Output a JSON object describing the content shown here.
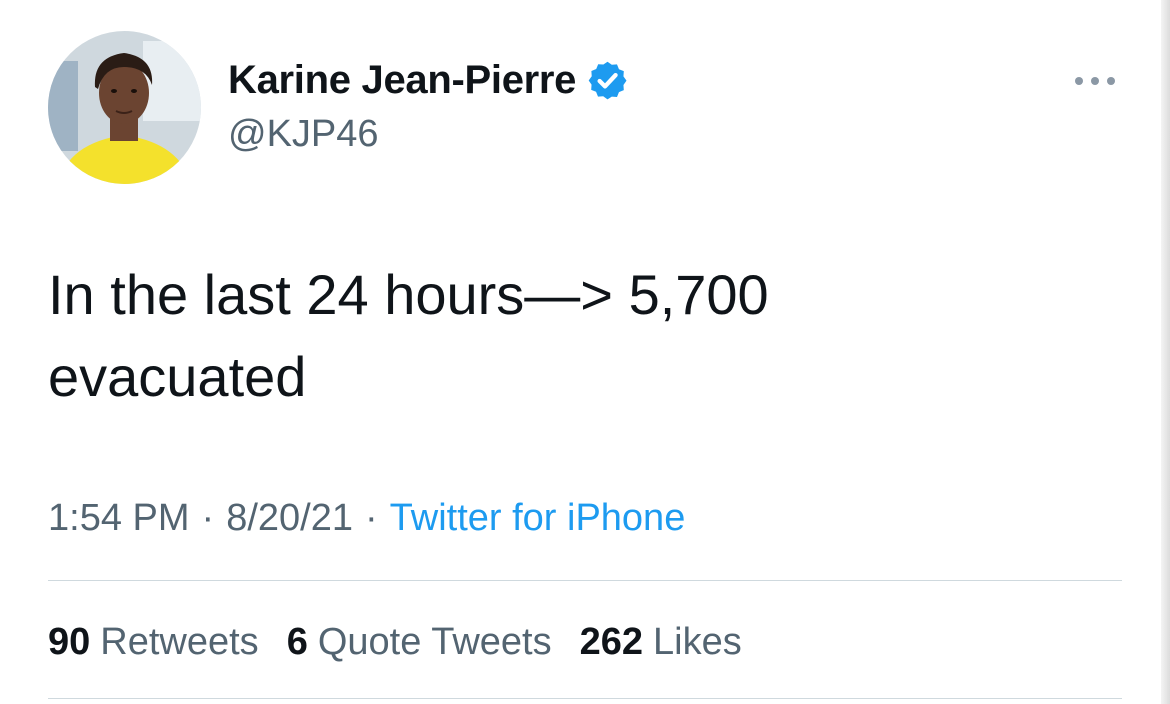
{
  "author": {
    "display_name": "Karine Jean-Pierre",
    "handle": "@KJP46",
    "verified": true,
    "avatar_colors": {
      "background": "#cfd8de",
      "skin": "#6b4431",
      "hair": "#2a1c15",
      "shirt": "#f4e12c"
    }
  },
  "tweet": {
    "text": "In the last 24 hours—> 5,700\nevacuated"
  },
  "meta": {
    "time": "1:54 PM",
    "separator": "·",
    "date": "8/20/21",
    "source": "Twitter for iPhone"
  },
  "stats": {
    "retweets_count": "90",
    "retweets_label": "Retweets",
    "quotes_count": "6",
    "quotes_label": "Quote Tweets",
    "likes_count": "262",
    "likes_label": "Likes"
  },
  "colors": {
    "accent": "#1d9bf0",
    "text_primary": "#0f1419",
    "text_secondary": "#536471",
    "divider": "#cfd9de"
  },
  "icons": {
    "verified": "verified-badge-icon",
    "more": "more-options-icon"
  }
}
